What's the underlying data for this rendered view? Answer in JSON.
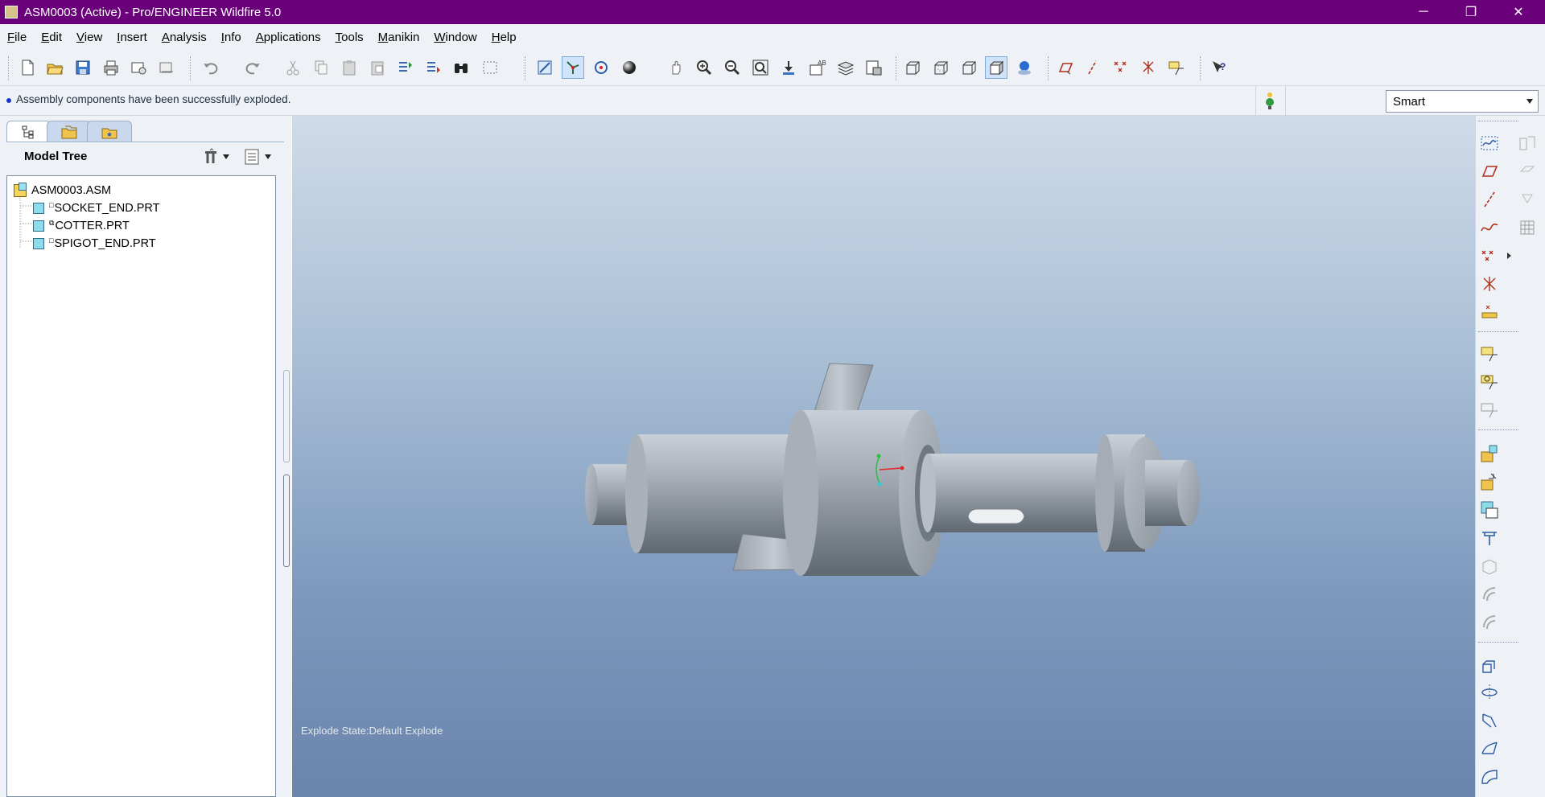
{
  "window": {
    "title": "ASM0003 (Active) - Pro/ENGINEER Wildfire 5.0",
    "minimize": "─",
    "restore": "❐",
    "close": "✕"
  },
  "menu": {
    "items": [
      {
        "first": "F",
        "rest": "ile"
      },
      {
        "first": "E",
        "rest": "dit"
      },
      {
        "first": "V",
        "rest": "iew"
      },
      {
        "first": "I",
        "rest": "nsert"
      },
      {
        "first": "A",
        "rest": "nalysis"
      },
      {
        "first": "I",
        "rest": "nfo"
      },
      {
        "first": "A",
        "rest": "pplications"
      },
      {
        "first": "T",
        "rest": "ools"
      },
      {
        "first": "M",
        "rest": "anikin"
      },
      {
        "first": "W",
        "rest": "indow"
      },
      {
        "first": "H",
        "rest": "elp"
      }
    ]
  },
  "message": {
    "text": "Assembly components have been successfully exploded."
  },
  "filter": {
    "value": "Smart"
  },
  "model_tree": {
    "title": "Model Tree",
    "root": "ASM0003.ASM",
    "parts": [
      "SOCKET_END.PRT",
      "COTTER.PRT",
      "SPIGOT_END.PRT"
    ]
  },
  "viewport": {
    "explode_state": "Explode State:Default Explode"
  },
  "colors": {
    "titlebar": "#6a007a",
    "chrome": "#eef2f7",
    "viewport_top": "#cfdbe9",
    "viewport_bottom": "#6a84ac"
  }
}
